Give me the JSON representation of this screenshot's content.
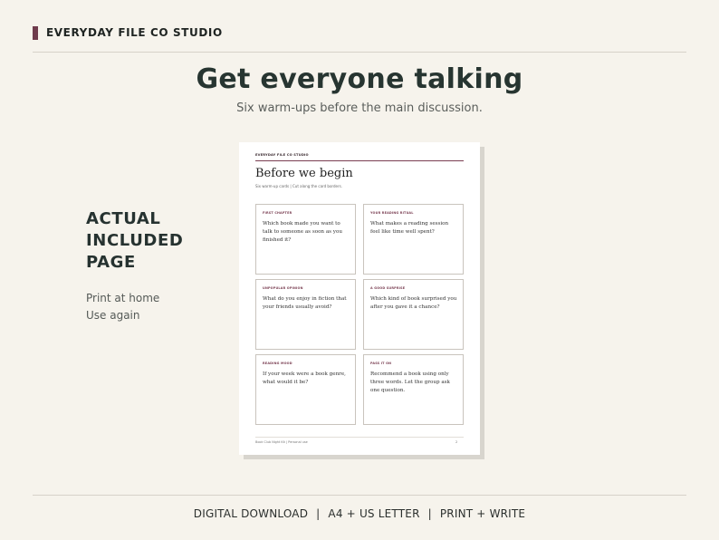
{
  "brand": {
    "name": "EVERYDAY FILE CO STUDIO",
    "accent": "#6f3b4c"
  },
  "hero": {
    "title": "Get everyone talking",
    "subtitle": "Six warm-ups before the main discussion."
  },
  "side": {
    "title_lines": [
      "ACTUAL",
      "INCLUDED",
      "PAGE"
    ],
    "items": [
      "Print at home",
      "Use again"
    ]
  },
  "document": {
    "brand": "EVERYDAY FILE CO STUDIO",
    "title": "Before we begin",
    "subtitle": "Six warm-up cards | Cut along the card borders.",
    "cards": [
      {
        "label": "FIRST CHAPTER",
        "question": "Which book made you want to talk to someone as soon as you finished it?"
      },
      {
        "label": "YOUR READING RITUAL",
        "question": "What makes a reading session feel like time well spent?"
      },
      {
        "label": "UNPOPULAR OPINION",
        "question": "What do you enjoy in fiction that your friends usually avoid?"
      },
      {
        "label": "A GOOD SURPRISE",
        "question": "Which kind of book surprised you after you gave it a chance?"
      },
      {
        "label": "READING MOOD",
        "question": "If your week were a book genre, what would it be?"
      },
      {
        "label": "PASS IT ON",
        "question": "Recommend a book using only three words. Let the group ask one question."
      }
    ],
    "footer_left": "Book Club Night Kit | Personal use",
    "footer_page": "2"
  },
  "footer": {
    "parts": [
      "DIGITAL DOWNLOAD",
      "A4 + US LETTER",
      "PRINT + WRITE"
    ],
    "separator": "|"
  }
}
